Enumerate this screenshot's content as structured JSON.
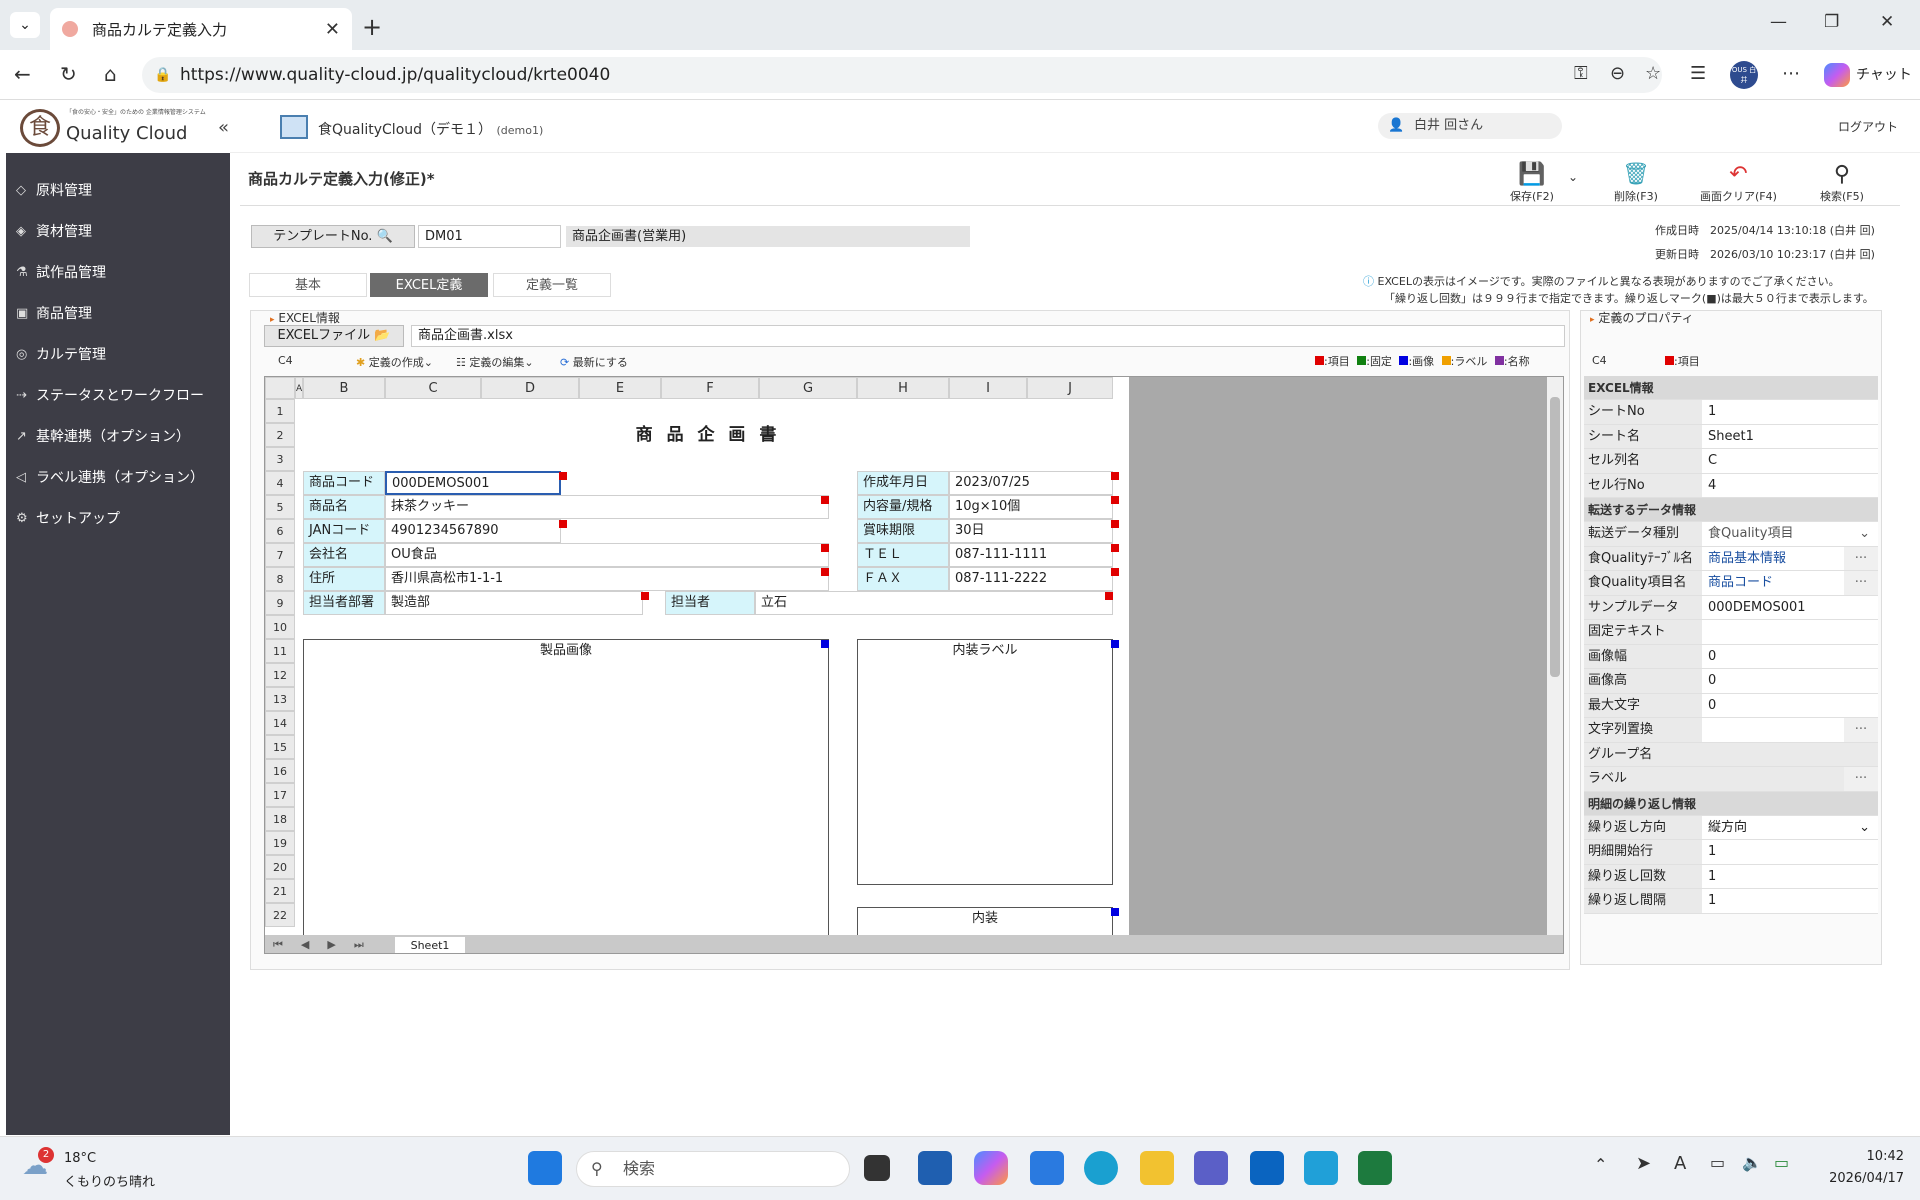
{
  "browser": {
    "tab_title": "商品カルテ定義入力",
    "url": "https://www.quality-cloud.jp/qualitycloud/krte0040",
    "profile_badge": "OUS 白井",
    "chat_label": "チャット"
  },
  "app": {
    "logo_text": "Quality Cloud",
    "logo_sub": "「食の安心・安全」のための 企業情報管理システム",
    "org_name": "食QualityCloud（デモ１）",
    "org_code": "(demo1)",
    "user_name": "白井 回さん",
    "logout": "ログアウト"
  },
  "sidebar": {
    "items": [
      {
        "label": "原料管理",
        "icon": "leaf-icon"
      },
      {
        "label": "資材管理",
        "icon": "box-icon"
      },
      {
        "label": "試作品管理",
        "icon": "flask-icon"
      },
      {
        "label": "商品管理",
        "icon": "gift-icon"
      },
      {
        "label": "カルテ管理",
        "icon": "layers-icon"
      },
      {
        "label": "ステータスとワークフロー",
        "icon": "workflow-icon"
      },
      {
        "label": "基幹連携（オプション）",
        "icon": "external-link-icon"
      },
      {
        "label": "ラベル連携（オプション）",
        "icon": "tag-icon"
      },
      {
        "label": "セットアップ",
        "icon": "gear-icon"
      }
    ]
  },
  "page": {
    "title": "商品カルテ定義入力(修正)*",
    "toolbar": {
      "save": "保存(F2)",
      "delete": "削除(F3)",
      "clear": "画面クリア(F4)",
      "search": "検索(F5)"
    },
    "template_btn": "テンプレートNo.",
    "template_no": "DM01",
    "template_name": "商品企画書(営業用)",
    "created_label": "作成日時",
    "created_value": "2025/04/14 13:10:18 (白井 回)",
    "updated_label": "更新日時",
    "updated_value": "2026/03/10 10:23:17 (白井 回)",
    "tabs": [
      "基本",
      "EXCEL定義",
      "定義一覧"
    ],
    "note1": "EXCELの表示はイメージです。実際のファイルと異なる表現がありますのでご了承ください。",
    "note2": "「繰り返し回数」は９９９行まで指定できます。繰り返しマーク(■)は最大５０行まで表示します。"
  },
  "excel": {
    "section": "EXCEL情報",
    "file_btn": "EXCELファイル",
    "file_name": "商品企画書.xlsx",
    "cell_ref": "C4",
    "menu": [
      "定義の作成",
      "定義の編集",
      "最新にする"
    ],
    "legend": [
      "項目",
      "固定",
      "画像",
      "ラベル",
      "名称"
    ],
    "legend_colors": [
      "#e00000",
      "#108010",
      "#0000e0",
      "#f0a000",
      "#8030a0"
    ],
    "columns": [
      "A",
      "B",
      "C",
      "D",
      "E",
      "F",
      "G",
      "H",
      "I",
      "J"
    ],
    "rows": [
      "1",
      "2",
      "3",
      "4",
      "5",
      "6",
      "7",
      "8",
      "9",
      "10",
      "11",
      "12",
      "13",
      "14",
      "15",
      "16",
      "17",
      "18",
      "19",
      "20",
      "21",
      "22"
    ],
    "sheet_tab": "Sheet1",
    "title": "商 品 企 画 書",
    "cells": {
      "code_label": "商品コード",
      "code_value": "000DEMOS001",
      "name_label": "商品名",
      "name_value": "抹茶クッキー",
      "jan_label": "JANコード",
      "jan_value": "4901234567890",
      "company_label": "会社名",
      "company_value": "OU食品",
      "address_label": "住所",
      "address_value": "香川県高松市1-1-1",
      "dept_label": "担当者部署",
      "dept_value": "製造部",
      "person_label": "担当者",
      "person_value": "立石",
      "date_label": "作成年月日",
      "date_value": "2023/07/25",
      "volume_label": "内容量/規格",
      "volume_value": "10g×10個",
      "expiry_label": "賞味期限",
      "expiry_value": "30日",
      "tel_label": "ＴＥＬ",
      "tel_value": "087-111-1111",
      "fax_label": "ＦＡＸ",
      "fax_value": "087-111-2222",
      "image_label": "製品画像",
      "inner_label": "内装ラベル",
      "inner": "内装"
    }
  },
  "props": {
    "section": "定義のプロパティ",
    "cell_ref": "C4",
    "legend": "項目",
    "group1": "EXCEL情報",
    "sheet_no_k": "シートNo",
    "sheet_no_v": "1",
    "sheet_name_k": "シート名",
    "sheet_name_v": "Sheet1",
    "col_k": "セル列名",
    "col_v": "C",
    "row_k": "セル行No",
    "row_v": "4",
    "group2": "転送するデータ情報",
    "type_k": "転送データ種別",
    "type_v": "食Quality項目",
    "table_k": "食Qualityﾃｰﾌﾞﾙ名",
    "table_v": "商品基本情報",
    "item_k": "食Quality項目名",
    "item_v": "商品コード",
    "sample_k": "サンプルデータ",
    "sample_v": "000DEMOS001",
    "fixed_k": "固定テキスト",
    "fixed_v": "",
    "imgw_k": "画像幅",
    "imgw_v": "0",
    "imgh_k": "画像高",
    "imgh_v": "0",
    "maxlen_k": "最大文字",
    "maxlen_v": "0",
    "replace_k": "文字列置換",
    "replace_v": "",
    "group_k": "グループ名",
    "group_v": "",
    "label_k": "ラベル",
    "label_v": "",
    "group3": "明細の繰り返し情報",
    "dir_k": "繰り返し方向",
    "dir_v": "縦方向",
    "start_k": "明細開始行",
    "start_v": "1",
    "count_k": "繰り返し回数",
    "count_v": "1",
    "interval_k": "繰り返し間隔",
    "interval_v": "1"
  },
  "taskbar": {
    "weather_temp": "18°C",
    "weather_text": "くもりのち晴れ",
    "weather_badge": "2",
    "search": "検索",
    "time": "10:42",
    "date": "2026/04/17"
  }
}
